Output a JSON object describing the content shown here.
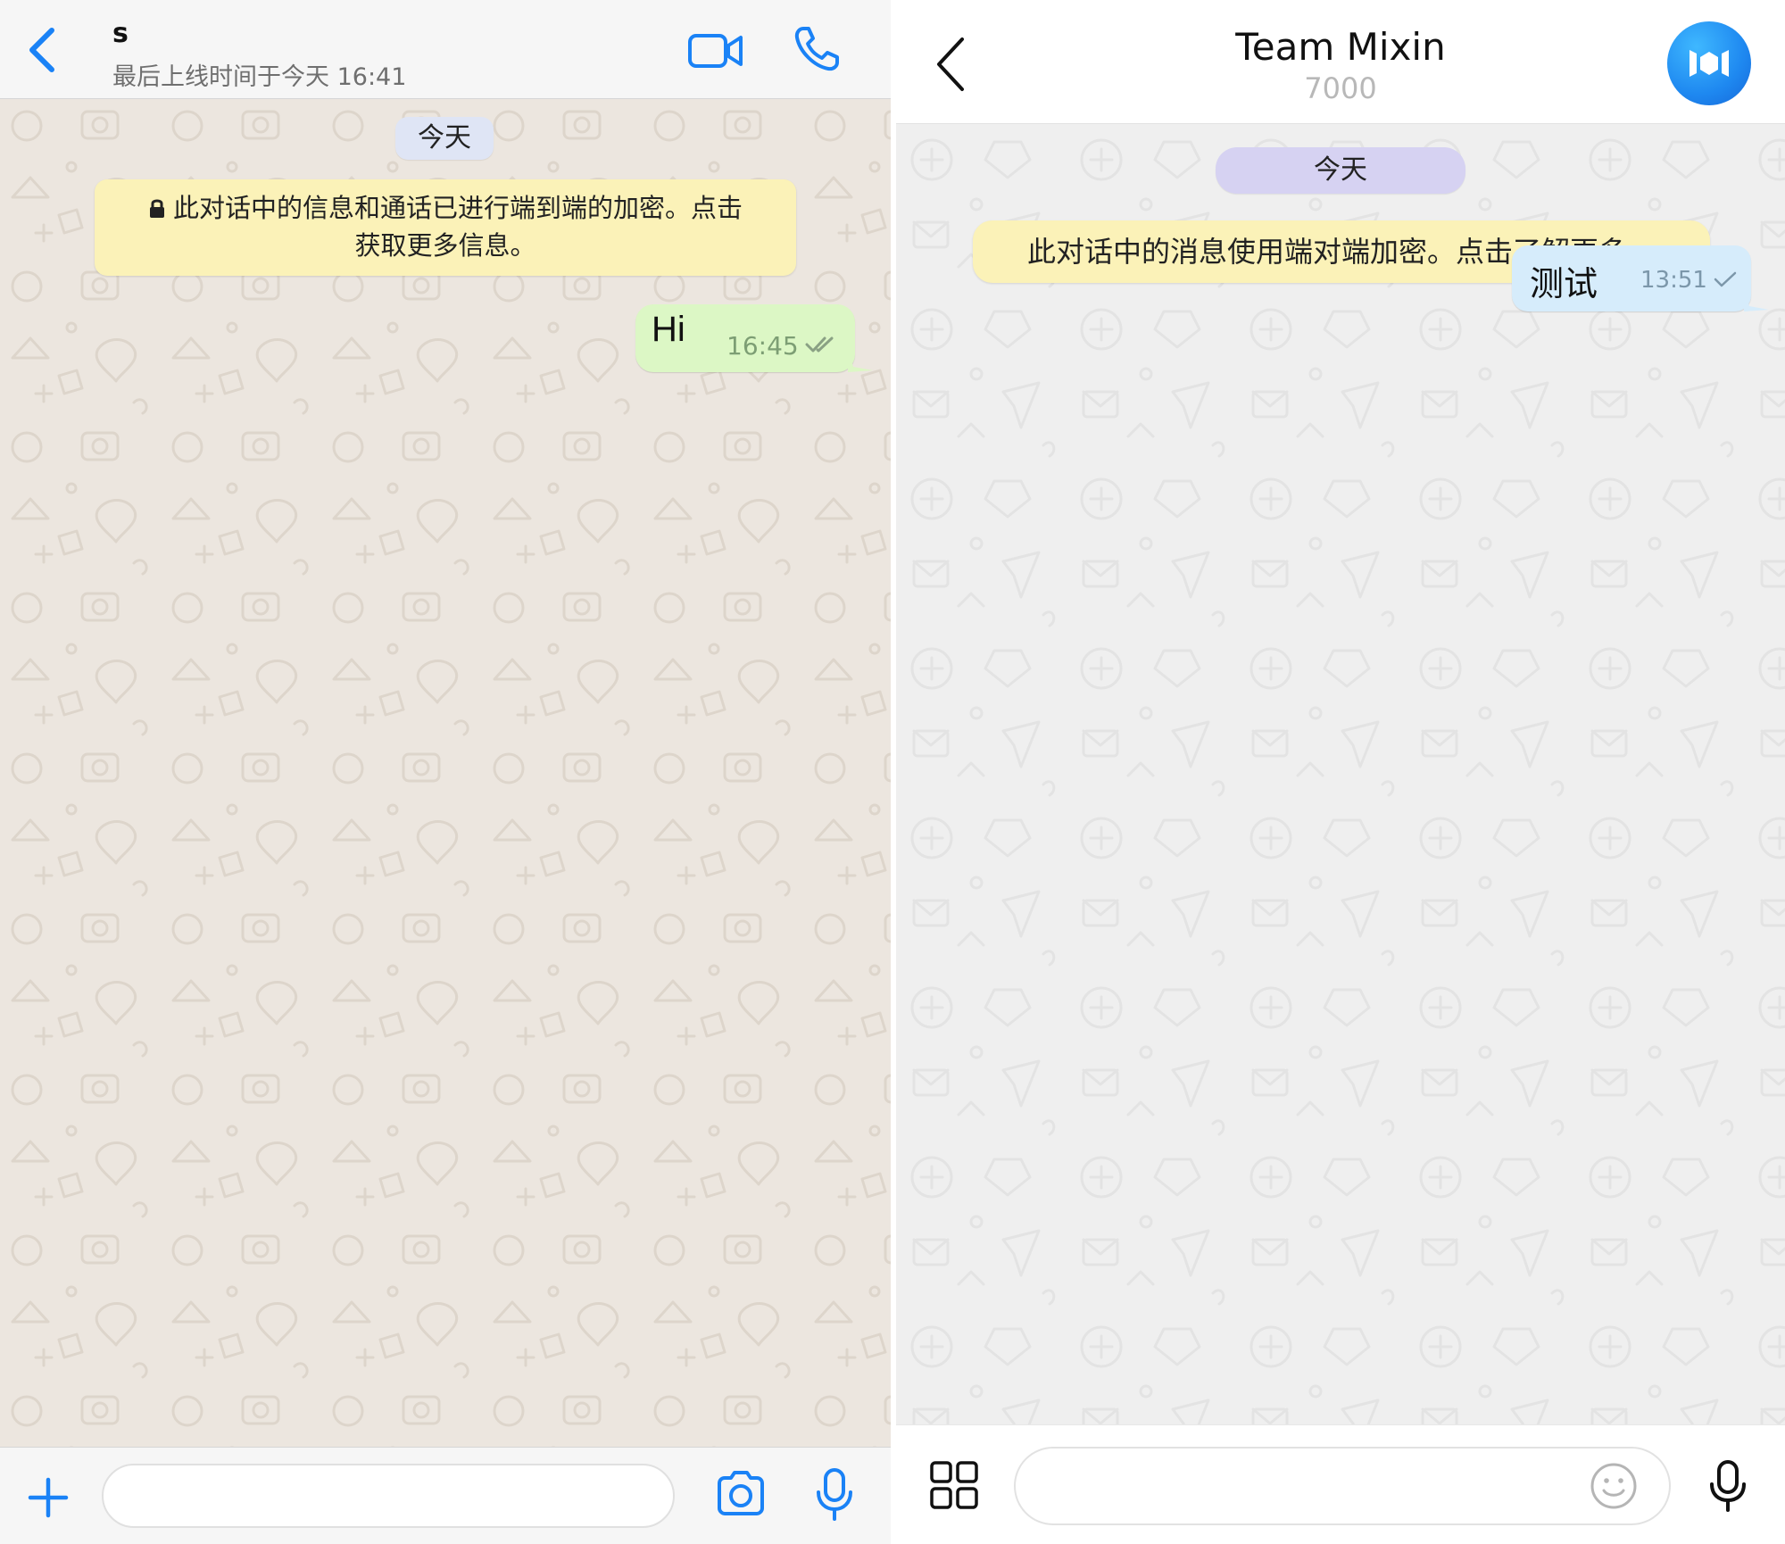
{
  "whatsapp": {
    "header": {
      "title": "s",
      "subtitle": "最后上线时间于今天 16:41"
    },
    "chat": {
      "date_label": "今天",
      "encryption_notice_line1": "此对话中的信息和通话已进行端到端的加密。点击",
      "encryption_notice_line2": "获取更多信息。",
      "messages": [
        {
          "text": "Hi",
          "time": "16:45"
        }
      ]
    },
    "input": {
      "placeholder": ""
    }
  },
  "mixin": {
    "header": {
      "title": "Team Mixin",
      "subtitle": "7000"
    },
    "chat": {
      "date_label": "今天",
      "encryption_notice": "此对话中的消息使用端对端加密。点击了解更多。",
      "messages": [
        {
          "text": "测试",
          "time": "13:51"
        }
      ]
    },
    "input": {
      "placeholder": ""
    }
  },
  "colors": {
    "wa_accent": "#1a82f6",
    "wa_outgoing_bubble": "#dcf7c5",
    "mixin_outgoing_bubble": "#d6ecfb",
    "notice_bg": "#fbf2b8",
    "mixin_avatar": "#1e88f0"
  },
  "icons": {
    "wa_back": "chevron-left-icon",
    "wa_video": "video-camera-icon",
    "wa_call": "phone-icon",
    "wa_attach": "plus-icon",
    "wa_camera": "camera-icon",
    "wa_mic": "microphone-icon",
    "mx_back": "chevron-left-icon",
    "mx_apps": "grid-icon",
    "mx_sticker": "smiley-icon",
    "mx_mic": "microphone-icon"
  }
}
